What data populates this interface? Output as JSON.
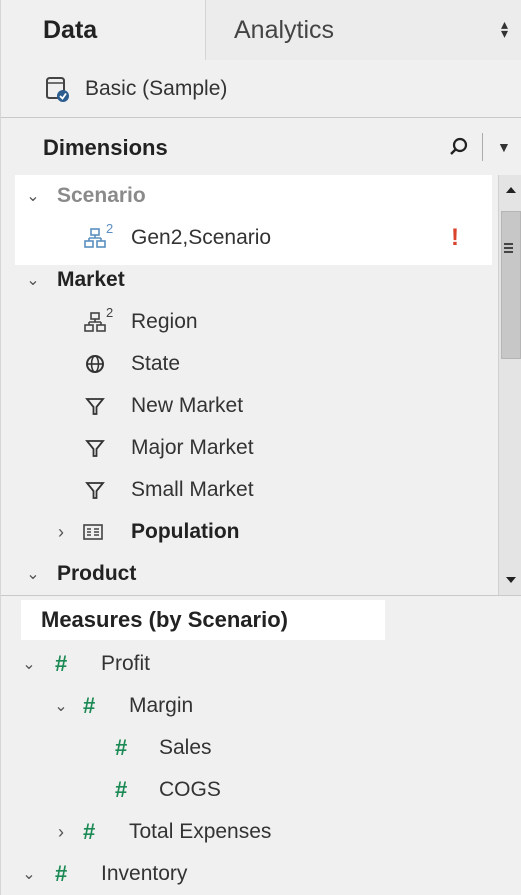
{
  "tabs": {
    "data": "Data",
    "analytics": "Analytics"
  },
  "datasource": {
    "name": "Basic (Sample)"
  },
  "dimensions": {
    "title": "Dimensions",
    "items": [
      {
        "label": "Scenario",
        "type": "folder",
        "expanded": true
      },
      {
        "label": "Gen2,Scenario",
        "type": "hierarchy",
        "icon": "hierarchy-icon",
        "warning": "!"
      },
      {
        "label": "Market",
        "type": "folder",
        "expanded": true
      },
      {
        "label": "Region",
        "type": "hierarchy",
        "icon": "hierarchy-icon"
      },
      {
        "label": "State",
        "type": "geo",
        "icon": "globe-icon"
      },
      {
        "label": "New Market",
        "type": "set",
        "icon": "filter-icon"
      },
      {
        "label": "Major Market",
        "type": "set",
        "icon": "filter-icon"
      },
      {
        "label": "Small Market",
        "type": "set",
        "icon": "filter-icon"
      },
      {
        "label": "Population",
        "type": "folder",
        "expanded": false,
        "icon": "attribute-icon"
      },
      {
        "label": "Product",
        "type": "folder",
        "expanded": true
      }
    ]
  },
  "measures": {
    "title": "Measures (by Scenario)",
    "items": [
      {
        "label": "Profit",
        "expanded": true
      },
      {
        "label": "Margin",
        "expanded": true
      },
      {
        "label": "Sales"
      },
      {
        "label": "COGS"
      },
      {
        "label": "Total Expenses",
        "expanded": false
      },
      {
        "label": "Inventory",
        "expanded": true
      }
    ]
  },
  "colors": {
    "accent_warning": "#d9422b",
    "measure_green": "#1c8a55",
    "hierarchy_blue": "#5a8fc0"
  }
}
